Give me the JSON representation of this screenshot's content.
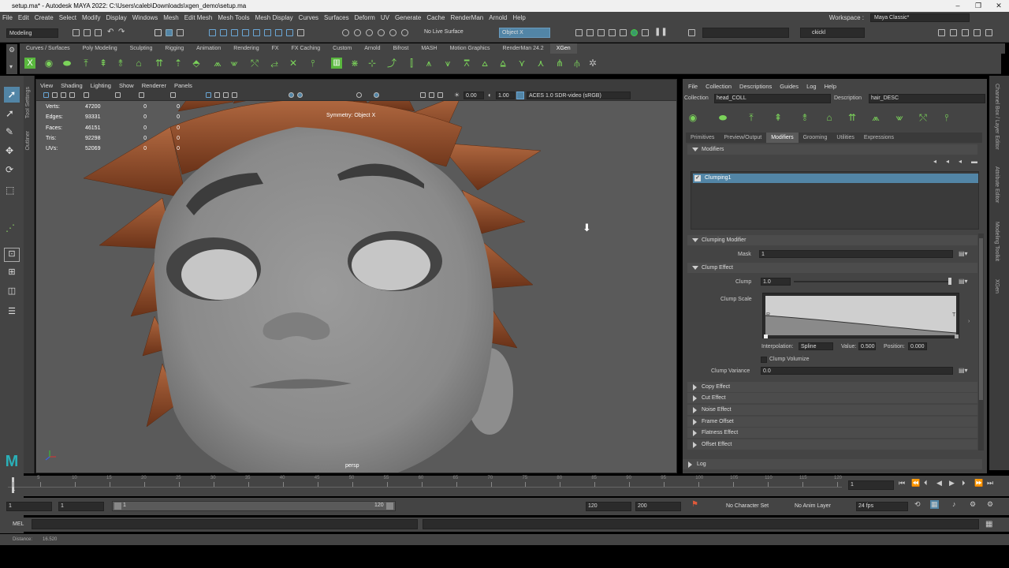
{
  "window": {
    "title": "setup.ma* - Autodesk MAYA 2022: C:\\Users\\caleb\\Downloads\\xgen_demo\\setup.ma",
    "controls": [
      "–",
      "❐",
      "✕"
    ]
  },
  "menubar": {
    "items": [
      "File",
      "Edit",
      "Create",
      "Select",
      "Modify",
      "Display",
      "Windows",
      "Mesh",
      "Edit Mesh",
      "Mesh Tools",
      "Mesh Display",
      "Curves",
      "Surfaces",
      "Deform",
      "UV",
      "Generate",
      "Cache",
      "RenderMan",
      "Arnold",
      "Help"
    ],
    "workspace_label": "Workspace :",
    "workspace_value": "Maya Classic*"
  },
  "statusline": {
    "mode": "Modeling",
    "live_surface": "No Live Surface",
    "symmetry": "Object X",
    "user": "ckickl"
  },
  "shelf": {
    "tabs": [
      "Curves / Surfaces",
      "Poly Modeling",
      "Sculpting",
      "Rigging",
      "Animation",
      "Rendering",
      "FX",
      "FX Caching",
      "Custom",
      "Arnold",
      "Bifrost",
      "MASH",
      "Motion Graphics",
      "RenderMan 24.2",
      "XGen"
    ],
    "active_tab": "XGen"
  },
  "left_strip": {
    "tool_settings": "Tool Settings",
    "outliner": "Outliner"
  },
  "viewport": {
    "menu": [
      "View",
      "Shading",
      "Lighting",
      "Show",
      "Renderer",
      "Panels"
    ],
    "exposure": "0.00",
    "gamma": "1.00",
    "colorspace": "ACES 1.0 SDR-video (sRGB)",
    "symmetry_label": "Symmetry: Object X",
    "camera": "persp",
    "hud": [
      {
        "label": "Verts:",
        "total": "47200",
        "sel": "0",
        "comp": "0"
      },
      {
        "label": "Edges:",
        "total": "93331",
        "sel": "0",
        "comp": "0"
      },
      {
        "label": "Faces:",
        "total": "46151",
        "sel": "0",
        "comp": "0"
      },
      {
        "label": "Tris:",
        "total": "92298",
        "sel": "0",
        "comp": "0"
      },
      {
        "label": "UVs:",
        "total": "52069",
        "sel": "0",
        "comp": "0"
      }
    ]
  },
  "xgen": {
    "menu": [
      "File",
      "Collection",
      "Descriptions",
      "Guides",
      "Log",
      "Help"
    ],
    "collection_label": "Collection",
    "collection_value": "head_COLL",
    "description_label": "Description",
    "description_value": "hair_DESC",
    "tabs": [
      "Primitives",
      "Preview/Output",
      "Modifiers",
      "Grooming",
      "Utilities",
      "Expressions"
    ],
    "active_tab": "Modifiers",
    "modifiers_header": "Modifiers",
    "modifier_item": "Clumping1",
    "clumping_header": "Clumping Modifier",
    "mask_label": "Mask",
    "mask_value": "1",
    "clump_effect_header": "Clump Effect",
    "clump_label": "Clump",
    "clump_value": "1.0",
    "clump_slider": 1.0,
    "clump_scale_label": "Clump Scale",
    "ramp_r": "R",
    "ramp_t": "T",
    "interp_label": "Interpolation:",
    "interp_value": "Spline",
    "value_label": "Value:",
    "value_value": "0.500",
    "position_label": "Position:",
    "position_value": "0.000",
    "clump_volumize": "Clump Volumize",
    "clump_variance_label": "Clump Variance",
    "clump_variance_value": "0.0",
    "collapsed_sections": [
      "Copy Effect",
      "Cut Effect",
      "Noise Effect",
      "Frame Offset",
      "Flatness Effect",
      "Offset Effect"
    ],
    "log_label": "Log"
  },
  "right_strip": [
    "Channel Box / Layer Editor",
    "Attribute Editor",
    "Modeling Toolkit",
    "XGen"
  ],
  "timeslider": {
    "ticks": [
      "1",
      "5",
      "10",
      "15",
      "20",
      "25",
      "30",
      "35",
      "40",
      "45",
      "50",
      "55",
      "60",
      "65",
      "70",
      "75",
      "80",
      "85",
      "90",
      "95",
      "100",
      "105",
      "110",
      "115",
      "120"
    ],
    "current_frame": "1"
  },
  "rangeslider": {
    "start": "1",
    "inner_start": "1",
    "range_start_label": "1",
    "range_end_label": "120",
    "end": "120",
    "outer_end": "200",
    "character_set": "No Character Set",
    "anim_layer": "No Anim Layer",
    "fps": "24 fps"
  },
  "cmdline": {
    "lang": "MEL"
  },
  "helpline": {
    "text": "Distance:",
    "value": "16.520"
  },
  "colors": {
    "accent": "#5285a6",
    "maya_bg": "#444444",
    "viewport_bg": "#5a5a5a",
    "hair": "#8a4a2a",
    "shelf_icon": "#7bd35a"
  }
}
